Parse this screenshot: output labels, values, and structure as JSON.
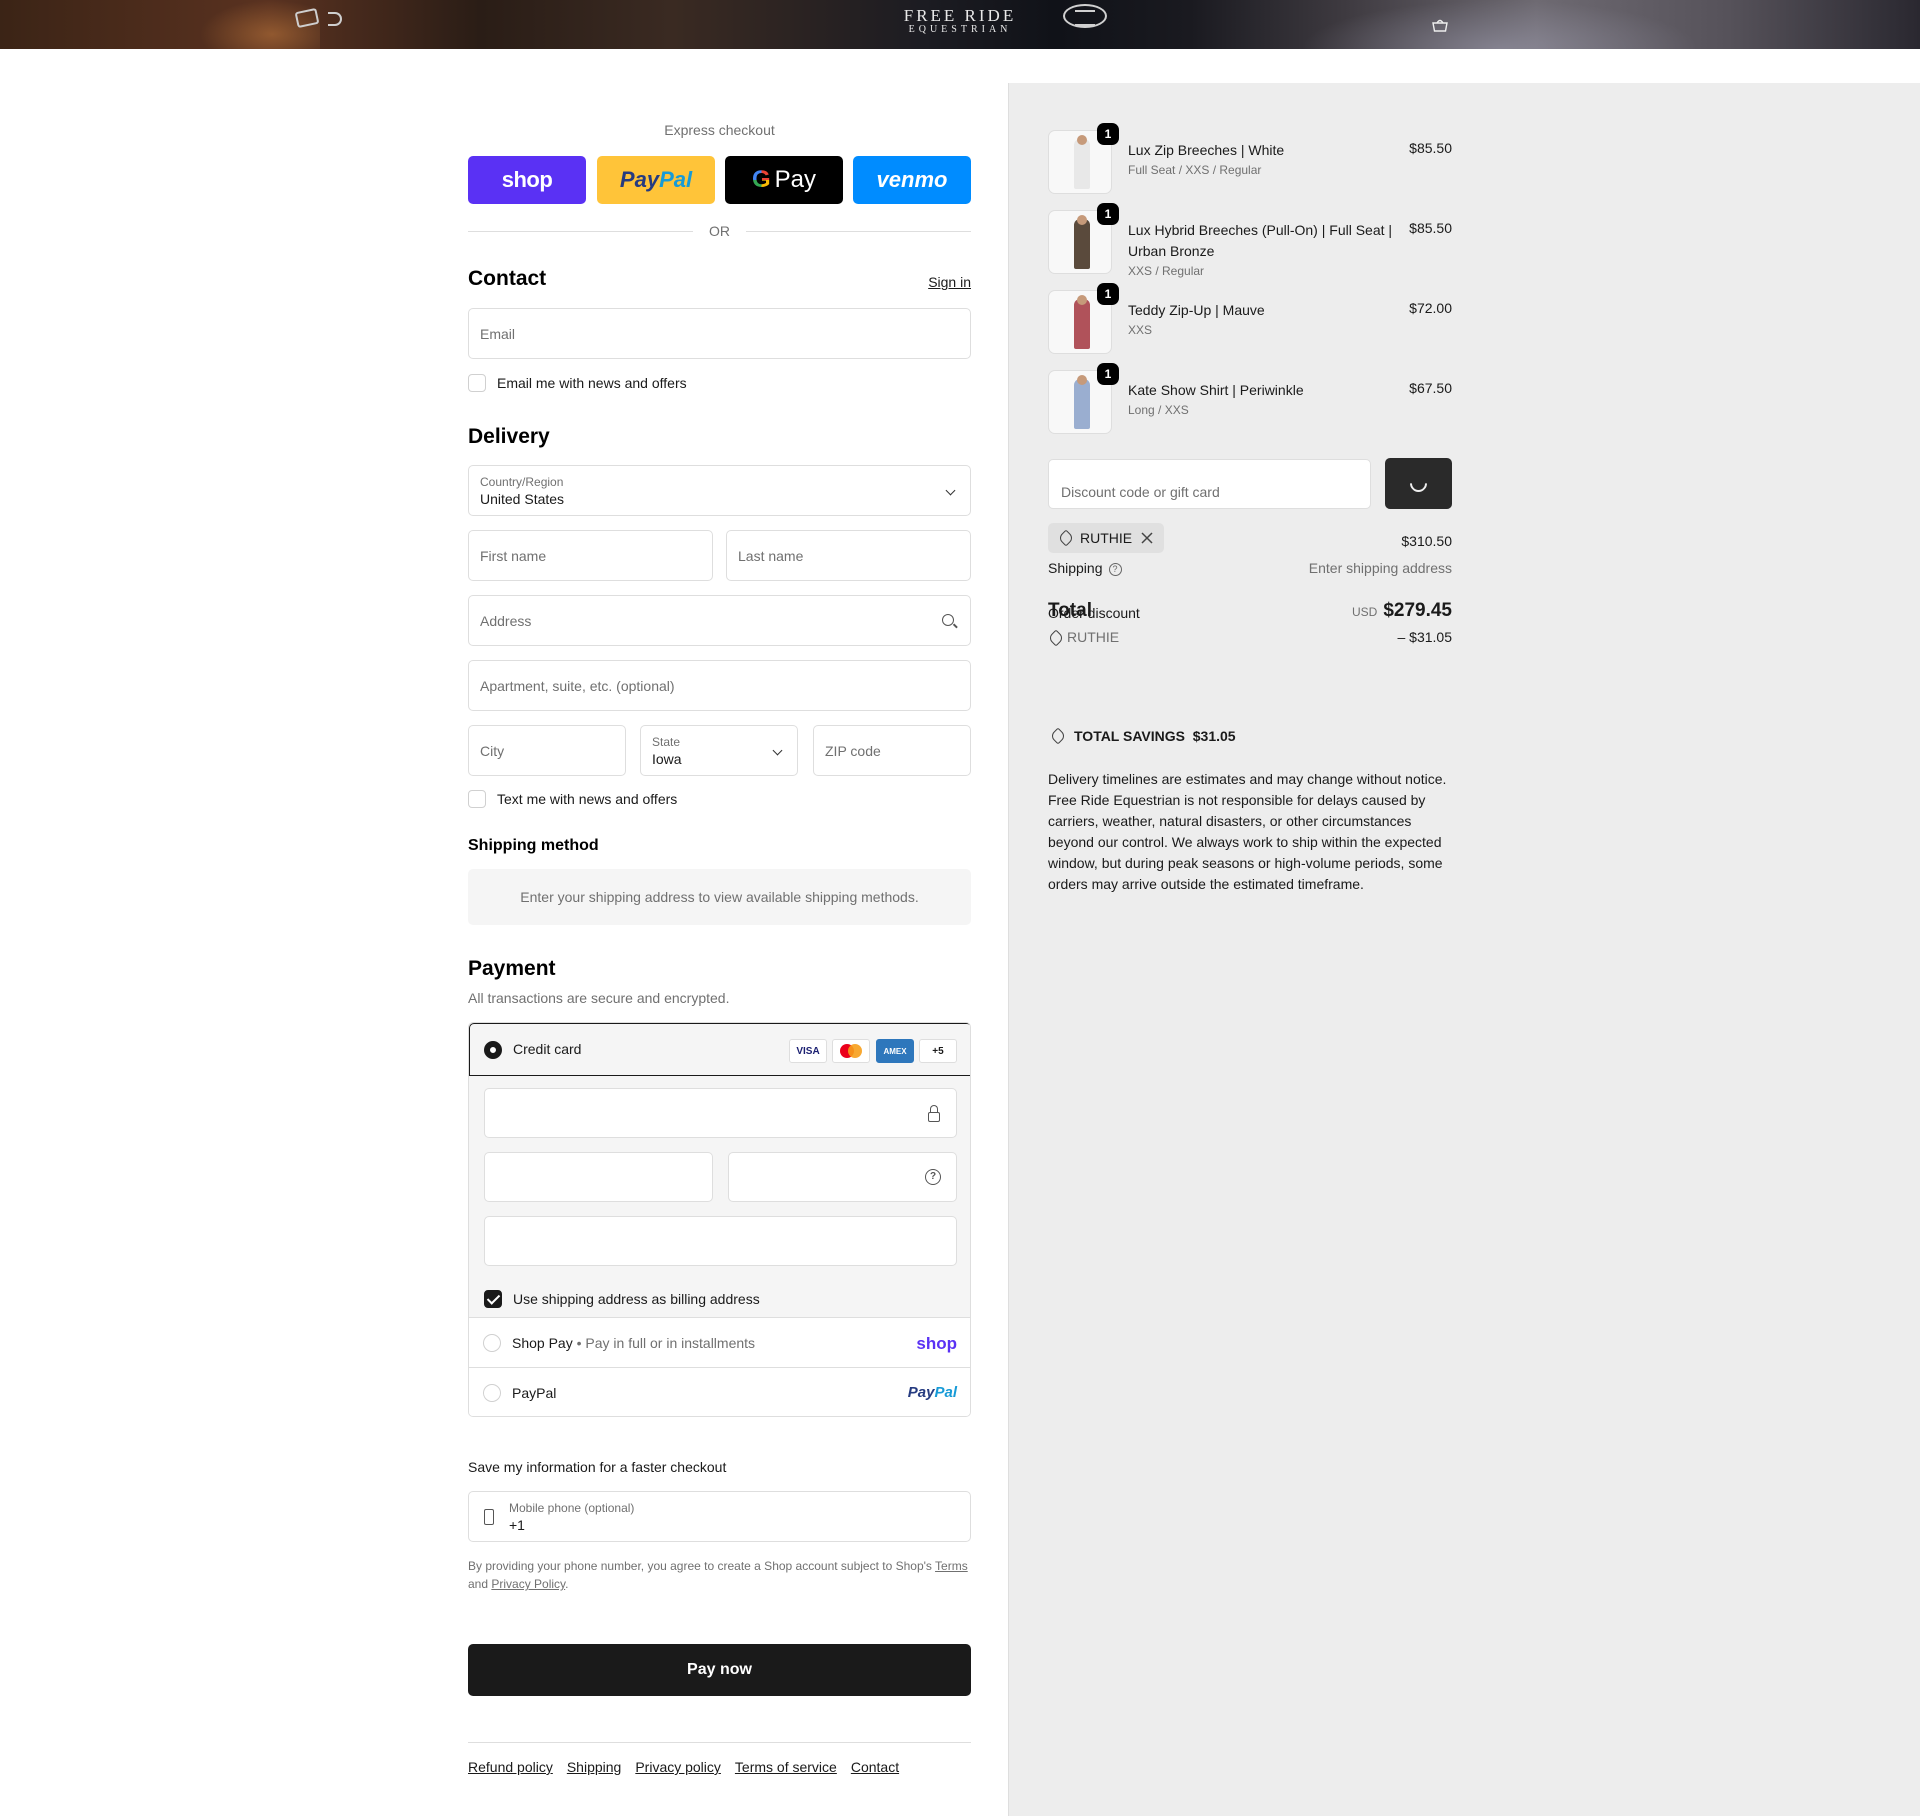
{
  "header": {
    "brand_line1": "FREE RIDE",
    "brand_line2": "EQUESTRIAN"
  },
  "express": {
    "title": "Express checkout",
    "buttons": {
      "shop": "shop",
      "paypal_a": "Pay",
      "paypal_b": "Pal",
      "gpay_g": "G",
      "gpay": "Pay",
      "venmo": "venmo"
    },
    "or": "OR"
  },
  "contact": {
    "heading": "Contact",
    "signin": "Sign in",
    "email_placeholder": "Email",
    "news_label": "Email me with news and offers"
  },
  "delivery": {
    "heading": "Delivery",
    "country_label": "Country/Region",
    "country_value": "United States",
    "first_name": "First name",
    "last_name": "Last name",
    "address": "Address",
    "apartment": "Apartment, suite, etc. (optional)",
    "city": "City",
    "state_label": "State",
    "state_value": "Iowa",
    "zip": "ZIP code",
    "text_label": "Text me with news and offers"
  },
  "shipping_method": {
    "heading": "Shipping method",
    "message": "Enter your shipping address to view available shipping methods."
  },
  "payment": {
    "heading": "Payment",
    "subtitle": "All transactions are secure and encrypted.",
    "credit_card": "Credit card",
    "cards": [
      "VISA",
      "MC",
      "AMEX",
      "+5"
    ],
    "billing_label": "Use shipping address as billing address",
    "shoppay_label": "Shop Pay",
    "shoppay_sub": "Pay in full or in installments",
    "shoppay_logo": "shop",
    "paypal_label": "PayPal",
    "paypal_logo_a": "Pay",
    "paypal_logo_b": "Pal"
  },
  "save": {
    "title": "Save my information for a faster checkout",
    "phone_label": "Mobile phone (optional)",
    "phone_value": "+1",
    "legal_pre": "By providing your phone number, you agree to create a Shop account subject to Shop's ",
    "legal_terms": "Terms",
    "legal_and": " and ",
    "legal_privacy": "Privacy Policy",
    "legal_end": "."
  },
  "pay_now": "Pay now",
  "footer": [
    "Refund policy",
    "Shipping",
    "Privacy policy",
    "Terms of service",
    "Contact"
  ],
  "summary": {
    "items": [
      {
        "name": "Lux Zip Breeches | White",
        "variant": "Full Seat / XXS / Regular",
        "price": "$85.50",
        "qty": "1",
        "color": "#e8e8e8"
      },
      {
        "name": "Lux Hybrid Breeches (Pull-On) | Full Seat | Urban Bronze",
        "variant": "XXS / Regular",
        "price": "$85.50",
        "qty": "1",
        "color": "#5a4a3c"
      },
      {
        "name": "Teddy Zip-Up | Mauve",
        "variant": "XXS",
        "price": "$72.00",
        "qty": "1",
        "color": "#b0525a"
      },
      {
        "name": "Kate Show Shirt | Periwinkle",
        "variant": "Long / XXS",
        "price": "$67.50",
        "qty": "1",
        "color": "#9aaed0"
      }
    ],
    "discount_placeholder": "Discount code or gift card",
    "code": "RUTHIE",
    "subtotal": "$310.50",
    "shipping_label": "Shipping",
    "shipping_value": "Enter shipping address",
    "total_label": "Total",
    "order_discount_label": "Order discount",
    "currency": "USD",
    "total": "$279.45",
    "discount_code": "RUTHIE",
    "discount_amount": "– $31.05",
    "savings_label": "TOTAL SAVINGS",
    "savings_value": "$31.05",
    "note": "Delivery timelines are estimates and may change without notice. Free Ride Equestrian is not responsible for delays caused by carriers, weather, natural disasters, or other circumstances beyond our control. We always work to ship within the expected window, but during peak seasons or high-volume periods, some orders may arrive outside the estimated timeframe."
  }
}
